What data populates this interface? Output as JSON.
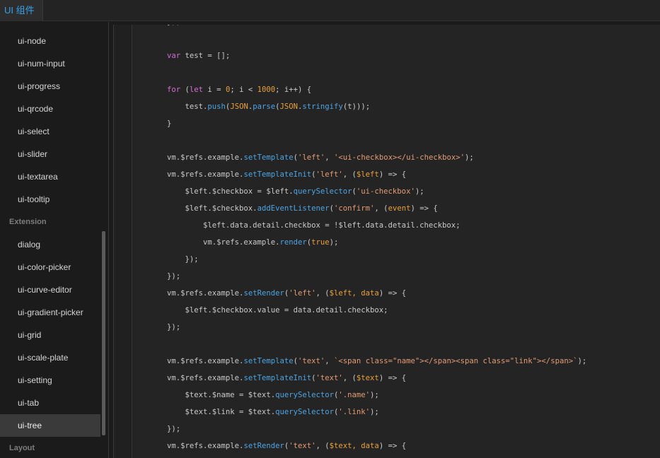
{
  "header": {
    "tab_label": "UI 组件"
  },
  "sidebar": {
    "items": [
      {
        "kind": "item",
        "label": "ui-node"
      },
      {
        "kind": "item",
        "label": "ui-num-input"
      },
      {
        "kind": "item",
        "label": "ui-progress"
      },
      {
        "kind": "item",
        "label": "ui-qrcode"
      },
      {
        "kind": "item",
        "label": "ui-select"
      },
      {
        "kind": "item",
        "label": "ui-slider"
      },
      {
        "kind": "item",
        "label": "ui-textarea"
      },
      {
        "kind": "item",
        "label": "ui-tooltip"
      },
      {
        "kind": "section",
        "label": "Extension"
      },
      {
        "kind": "item",
        "label": "dialog"
      },
      {
        "kind": "item",
        "label": "ui-color-picker"
      },
      {
        "kind": "item",
        "label": "ui-curve-editor"
      },
      {
        "kind": "item",
        "label": "ui-gradient-picker"
      },
      {
        "kind": "item",
        "label": "ui-grid"
      },
      {
        "kind": "item",
        "label": "ui-scale-plate"
      },
      {
        "kind": "item",
        "label": "ui-setting"
      },
      {
        "kind": "item",
        "label": "ui-tab"
      },
      {
        "kind": "item",
        "label": "ui-tree",
        "active": true
      },
      {
        "kind": "section",
        "label": "Layout"
      }
    ]
  },
  "editor": {
    "colors": {
      "background": "#242424",
      "keyword": "#d070cf",
      "function": "#4fa3e0",
      "string": "#e29b76",
      "number": "#e8a03a",
      "plain": "#c9c9c9"
    },
    "lines": [
      [
        [
          "pn",
          "});"
        ]
      ],
      [],
      [
        [
          "kw",
          "var"
        ],
        [
          "pn",
          " test = [];"
        ]
      ],
      [],
      [
        [
          "kw",
          "for"
        ],
        [
          "pn",
          " ("
        ],
        [
          "kw",
          "let"
        ],
        [
          "pn",
          " i = "
        ],
        [
          "nm",
          "0"
        ],
        [
          "pn",
          "; i < "
        ],
        [
          "nm",
          "1000"
        ],
        [
          "pn",
          "; i++) {"
        ]
      ],
      [
        [
          "pn",
          "    test."
        ],
        [
          "fn",
          "push"
        ],
        [
          "pn",
          "("
        ],
        [
          "ar",
          "JSON"
        ],
        [
          "pn",
          "."
        ],
        [
          "fn",
          "parse"
        ],
        [
          "pn",
          "("
        ],
        [
          "ar",
          "JSON"
        ],
        [
          "pn",
          "."
        ],
        [
          "fn",
          "stringify"
        ],
        [
          "pn",
          "(t)));"
        ]
      ],
      [
        [
          "pn",
          "}"
        ]
      ],
      [],
      [
        [
          "pn",
          "vm.$refs.example."
        ],
        [
          "fn",
          "setTemplate"
        ],
        [
          "pn",
          "("
        ],
        [
          "st",
          "'left'"
        ],
        [
          "pn",
          ", "
        ],
        [
          "st",
          "'<ui-checkbox></ui-checkbox>'"
        ],
        [
          "pn",
          ");"
        ]
      ],
      [
        [
          "pn",
          "vm.$refs.example."
        ],
        [
          "fn",
          "setTemplateInit"
        ],
        [
          "pn",
          "("
        ],
        [
          "st",
          "'left'"
        ],
        [
          "pn",
          ", ("
        ],
        [
          "ar",
          "$left"
        ],
        [
          "pn",
          ") => {"
        ]
      ],
      [
        [
          "pn",
          "    $left.$checkbox = $left."
        ],
        [
          "fn",
          "querySelector"
        ],
        [
          "pn",
          "("
        ],
        [
          "st",
          "'ui-checkbox'"
        ],
        [
          "pn",
          ");"
        ]
      ],
      [
        [
          "pn",
          "    $left.$checkbox."
        ],
        [
          "fn",
          "addEventListener"
        ],
        [
          "pn",
          "("
        ],
        [
          "st",
          "'confirm'"
        ],
        [
          "pn",
          ", ("
        ],
        [
          "ar",
          "event"
        ],
        [
          "pn",
          ") => {"
        ]
      ],
      [
        [
          "pn",
          "        $left.data.detail.checkbox = !$left.data.detail.checkbox;"
        ]
      ],
      [
        [
          "pn",
          "        vm.$refs.example."
        ],
        [
          "fn",
          "render"
        ],
        [
          "pn",
          "("
        ],
        [
          "ar",
          "true"
        ],
        [
          "pn",
          ");"
        ]
      ],
      [
        [
          "pn",
          "    });"
        ]
      ],
      [
        [
          "pn",
          "});"
        ]
      ],
      [
        [
          "pn",
          "vm.$refs.example."
        ],
        [
          "fn",
          "setRender"
        ],
        [
          "pn",
          "("
        ],
        [
          "st",
          "'left'"
        ],
        [
          "pn",
          ", ("
        ],
        [
          "ar",
          "$left, data"
        ],
        [
          "pn",
          ") => {"
        ]
      ],
      [
        [
          "pn",
          "    $left.$checkbox.value = data.detail.checkbox;"
        ]
      ],
      [
        [
          "pn",
          "});"
        ]
      ],
      [],
      [
        [
          "pn",
          "vm.$refs.example."
        ],
        [
          "fn",
          "setTemplate"
        ],
        [
          "pn",
          "("
        ],
        [
          "st",
          "'text'"
        ],
        [
          "pn",
          ", "
        ],
        [
          "st",
          "`<span class=\"name\"></span><span class=\"link\"></span>`"
        ],
        [
          "pn",
          ");"
        ]
      ],
      [
        [
          "pn",
          "vm.$refs.example."
        ],
        [
          "fn",
          "setTemplateInit"
        ],
        [
          "pn",
          "("
        ],
        [
          "st",
          "'text'"
        ],
        [
          "pn",
          ", ("
        ],
        [
          "ar",
          "$text"
        ],
        [
          "pn",
          ") => {"
        ]
      ],
      [
        [
          "pn",
          "    $text.$name = $text."
        ],
        [
          "fn",
          "querySelector"
        ],
        [
          "pn",
          "("
        ],
        [
          "st",
          "'.name'"
        ],
        [
          "pn",
          ");"
        ]
      ],
      [
        [
          "pn",
          "    $text.$link = $text."
        ],
        [
          "fn",
          "querySelector"
        ],
        [
          "pn",
          "("
        ],
        [
          "st",
          "'.link'"
        ],
        [
          "pn",
          ");"
        ]
      ],
      [
        [
          "pn",
          "});"
        ]
      ],
      [
        [
          "pn",
          "vm.$refs.example."
        ],
        [
          "fn",
          "setRender"
        ],
        [
          "pn",
          "("
        ],
        [
          "st",
          "'text'"
        ],
        [
          "pn",
          ", ("
        ],
        [
          "ar",
          "$text, data"
        ],
        [
          "pn",
          ") => {"
        ]
      ]
    ]
  }
}
